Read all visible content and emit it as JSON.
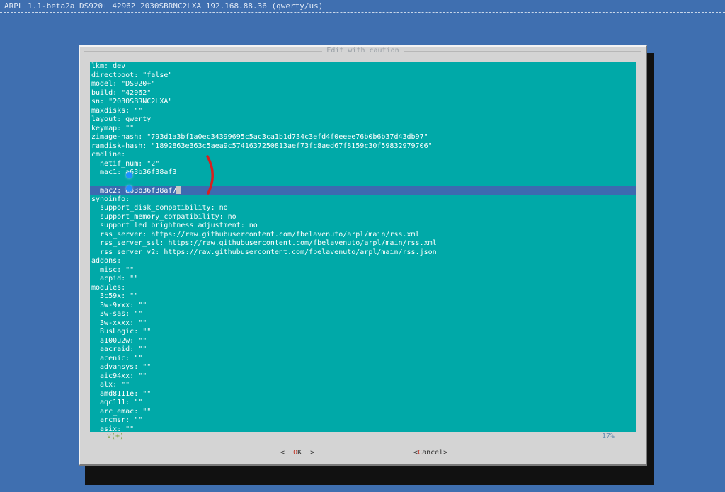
{
  "backtitle": "ARPL 1.1-beta2a DS920+ 42962 2030SBRNC2LXA 192.168.88.36 (qwerty/us)",
  "dialog": {
    "title": "Edit with caution",
    "status_left": "v(+)",
    "status_right": "17%",
    "buttons": {
      "ok": {
        "pre": "<  ",
        "hotkey": "O",
        "rest": "K",
        "post": "  >"
      },
      "cancel": {
        "pre": "<",
        "hotkey": "C",
        "rest": "ancel",
        "post": ">"
      }
    }
  },
  "editor": {
    "current_line_index": 14,
    "lines": [
      "lkm: dev",
      "directboot: \"false\"",
      "model: \"DS920+\"",
      "build: \"42962\"",
      "sn: \"2030SBRNC2LXA\"",
      "maxdisks: \"\"",
      "layout: qwerty",
      "keymap: \"\"",
      "zimage-hash: \"793d1a3bf1a0ec34399695c5ac3ca1b1d734c3efd4f0eeee76b0b6b37d43db97\"",
      "ramdisk-hash: \"1892863e363c5aea9c5741637250813aef73fc8aed67f8159c30f59832979706\"",
      "cmdline:",
      "  netif_num: \"2\"",
      "  mac1: a63b36f38af3",
      "",
      "  mac2: a63b36f38af7",
      "synoinfo:",
      "  support_disk_compatibility: no",
      "  support_memory_compatibility: no",
      "  support_led_brightness_adjustment: no",
      "  rss_server: https://raw.githubusercontent.com/fbelavenuto/arpl/main/rss.xml",
      "  rss_server_ssl: https://raw.githubusercontent.com/fbelavenuto/arpl/main/rss.xml",
      "  rss_server_v2: https://raw.githubusercontent.com/fbelavenuto/arpl/main/rss.json",
      "addons:",
      "  misc: \"\"",
      "  acpid: \"\"",
      "modules:",
      "  3c59x: \"\"",
      "  3w-9xxx: \"\"",
      "  3w-sas: \"\"",
      "  3w-xxxx: \"\"",
      "  BusLogic: \"\"",
      "  a100u2w: \"\"",
      "  aacraid: \"\"",
      "  acenic: \"\"",
      "  advansys: \"\"",
      "  aic94xx: \"\"",
      "  alx: \"\"",
      "  amd8111e: \"\"",
      "  aqc111: \"\"",
      "  arc_emac: \"\"",
      "  arcmsr: \"\"",
      "  asix: \"\""
    ]
  }
}
